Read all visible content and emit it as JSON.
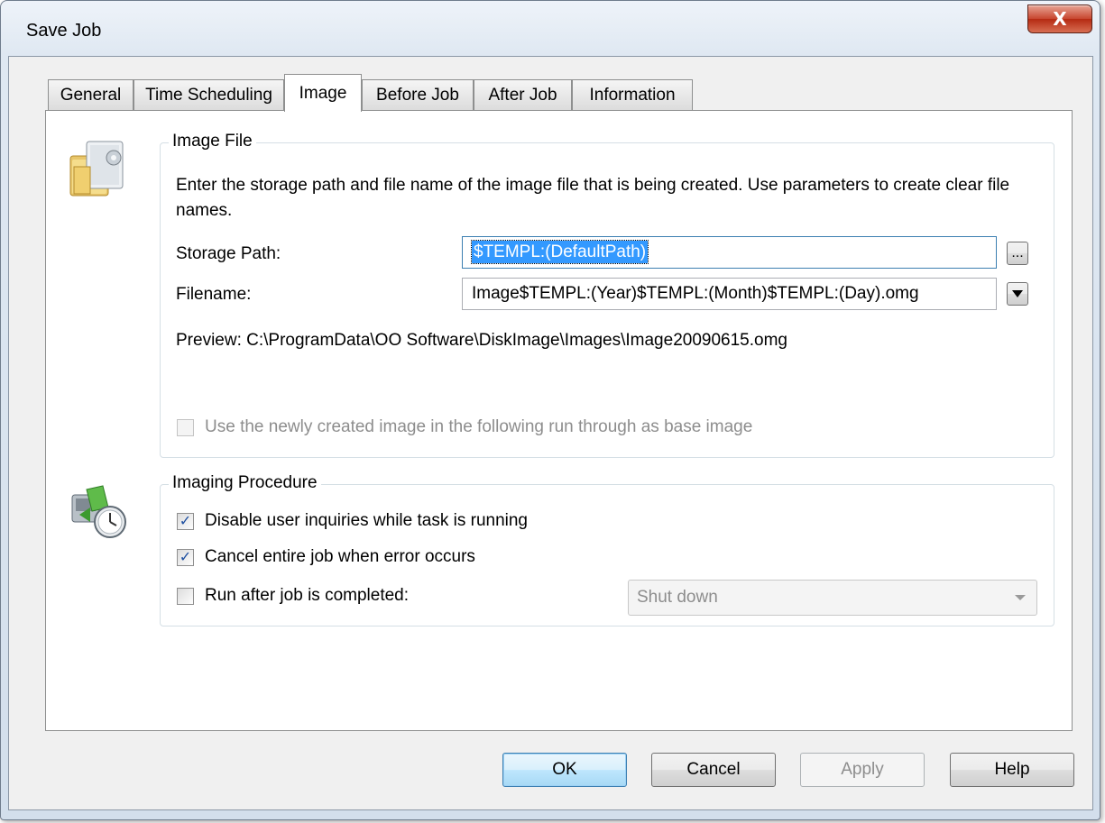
{
  "window": {
    "title": "Save Job",
    "close_symbol": "X"
  },
  "tabs": [
    {
      "label": "General"
    },
    {
      "label": "Time Scheduling"
    },
    {
      "label": "Image"
    },
    {
      "label": "Before Job"
    },
    {
      "label": "After Job"
    },
    {
      "label": "Information"
    }
  ],
  "active_tab": "Image",
  "image_file": {
    "group_title": "Image File",
    "description": "Enter the storage path and file name of the image file that is being created. Use parameters to create clear file names.",
    "storage_path_label": "Storage Path:",
    "storage_path_value": "$TEMPL:(DefaultPath)",
    "browse_label": "...",
    "filename_label": "Filename:",
    "filename_value": "Image$TEMPL:(Year)$TEMPL:(Month)$TEMPL:(Day).omg",
    "preview_text": "Preview: C:\\ProgramData\\OO Software\\DiskImage\\Images\\Image20090615.omg",
    "base_image_label": "Use the newly created image in the following run through as base image",
    "base_image_checked": false
  },
  "imaging_procedure": {
    "group_title": "Imaging Procedure",
    "disable_inquiries_label": "Disable user inquiries while task is running",
    "disable_inquiries_checked": true,
    "cancel_on_error_label": "Cancel entire job when error occurs",
    "cancel_on_error_checked": true,
    "run_after_label": "Run after job is completed:",
    "run_after_checked": false,
    "run_after_value": "Shut down"
  },
  "buttons": {
    "ok": "OK",
    "cancel": "Cancel",
    "apply": "Apply",
    "help": "Help"
  },
  "icons": {
    "image_file_icon": "folder-image-icon",
    "imaging_procedure_icon": "disk-clock-icon",
    "check_mark": "✓"
  }
}
